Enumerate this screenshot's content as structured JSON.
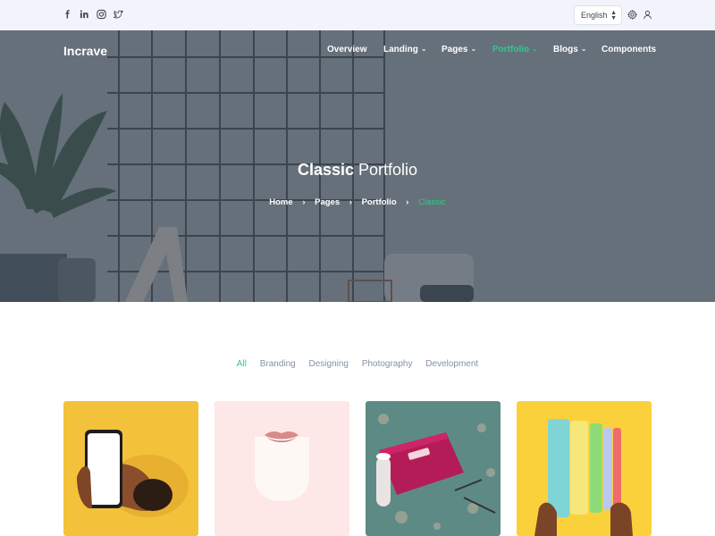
{
  "topbar": {
    "social_icons": [
      "facebook-icon",
      "linkedin-icon",
      "instagram-icon",
      "twitter-icon"
    ],
    "language": "English",
    "right_icons": [
      "settings-icon",
      "user-icon"
    ]
  },
  "header": {
    "brand": "Incrave",
    "nav": [
      {
        "label": "Overview",
        "caret": false
      },
      {
        "label": "Landing",
        "caret": true
      },
      {
        "label": "Pages",
        "caret": true
      },
      {
        "label": "Portfolio",
        "caret": true,
        "active": true
      },
      {
        "label": "Blogs",
        "caret": true
      },
      {
        "label": "Components",
        "caret": false
      }
    ]
  },
  "hero": {
    "title_bold": "Classic",
    "title_rest": " Portfolio",
    "breadcrumbs": [
      "Home",
      "Pages",
      "Portfolio",
      "Classic"
    ]
  },
  "filters": {
    "items": [
      "All",
      "Branding",
      "Designing",
      "Photography",
      "Development"
    ],
    "active": "All"
  },
  "portfolio": {
    "items": [
      {
        "image": "phone-in-hand-image"
      },
      {
        "image": "lips-pink-image"
      },
      {
        "image": "business-card-mockup-image"
      },
      {
        "image": "colored-books-image"
      }
    ]
  },
  "colors": {
    "accent": "#2eca8b",
    "text_dark": "#3c4858",
    "text_muted": "#8492a6",
    "topbar_bg": "#f3f4fb"
  }
}
